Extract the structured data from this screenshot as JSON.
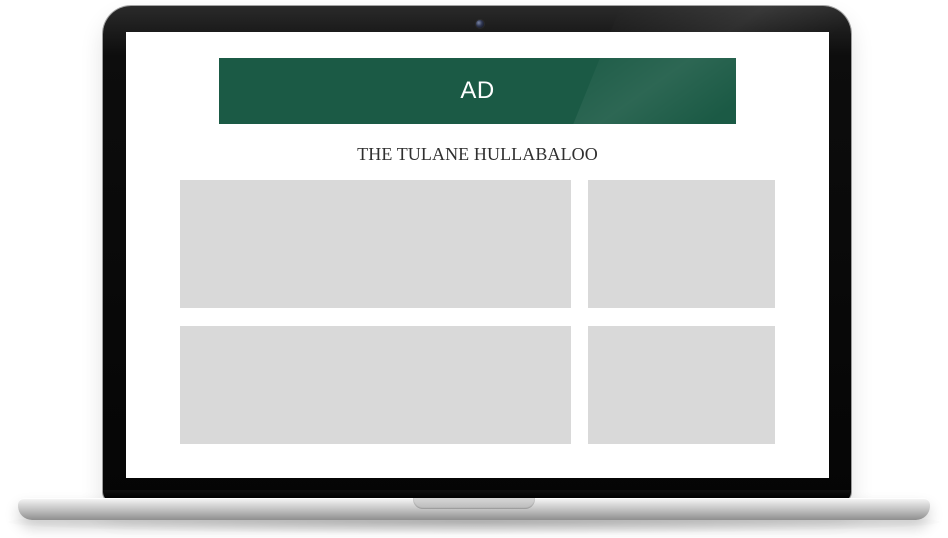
{
  "screen": {
    "ad_label": "AD",
    "site_title": "THE TULANE HULLABALOO"
  },
  "colors": {
    "ad_background": "#1b5a45",
    "card_background": "#d9d9d9"
  }
}
